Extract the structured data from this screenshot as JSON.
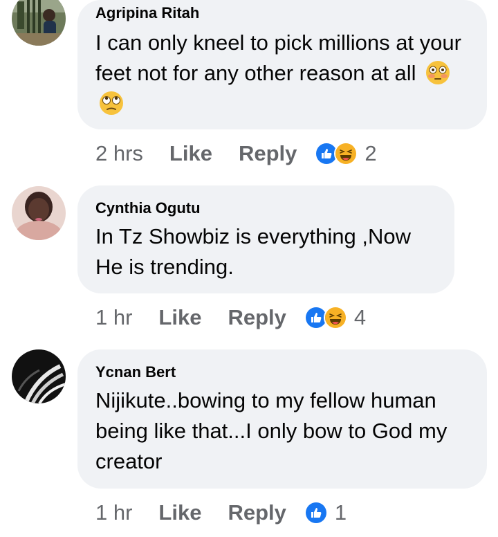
{
  "comments": [
    {
      "author": "Agripina Ritah",
      "text": "I can only kneel to pick millions at your feet not for any other reason at all",
      "emojis": [
        "flushed-face-emoji",
        "face-with-rolling-eyes-emoji"
      ],
      "time": "2 hrs",
      "like_label": "Like",
      "reply_label": "Reply",
      "reactions": [
        "like-reaction-icon",
        "haha-reaction-icon"
      ],
      "reaction_count": "2"
    },
    {
      "author": "Cynthia Ogutu",
      "text": "In Tz Showbiz is everything ,Now He is trending.",
      "emojis": [],
      "time": "1 hr",
      "like_label": "Like",
      "reply_label": "Reply",
      "reactions": [
        "like-reaction-icon",
        "haha-reaction-icon"
      ],
      "reaction_count": "4"
    },
    {
      "author": "Ycnan Bert",
      "text": "Nijikute..bowing to my fellow human being like that...I only bow to God my creator",
      "emojis": [],
      "time": "1 hr",
      "like_label": "Like",
      "reply_label": "Reply",
      "reactions": [
        "like-reaction-icon"
      ],
      "reaction_count": "1"
    }
  ],
  "colors": {
    "bubble": "#f0f2f5",
    "meta_text": "#65676b",
    "like_blue": "#1877f2",
    "haha_yellow": "#f7b125"
  }
}
